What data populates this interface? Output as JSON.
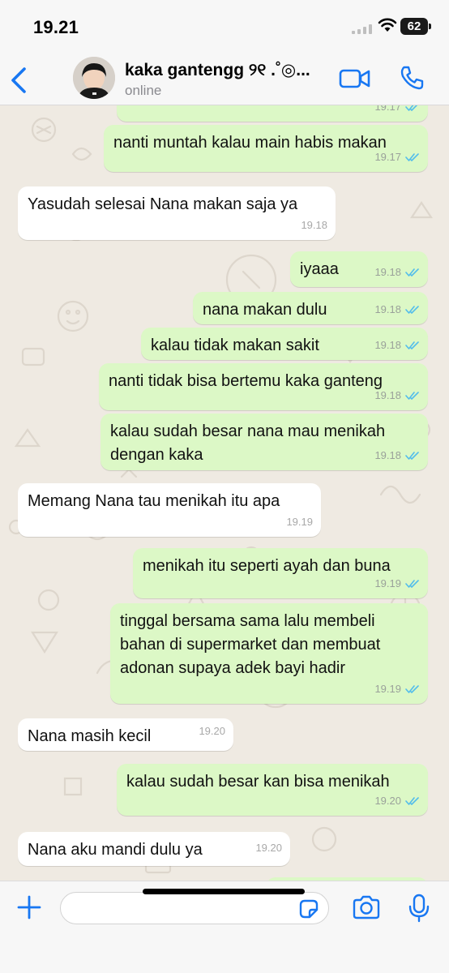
{
  "status_bar": {
    "time": "19.21",
    "battery": "62"
  },
  "header": {
    "back_label": "",
    "contact_name": "kaka gantengg ୨୧ . ˚✧ ... ",
    "contact_name_display": "kaka gantengg ୨୧ .˚◎...",
    "status": "online"
  },
  "messages": [
    {
      "direction": "out",
      "text": "",
      "time": "19.17",
      "read": true
    },
    {
      "direction": "out",
      "text": "nanti muntah kalau main habis makan",
      "time": "19.17",
      "read": true
    },
    {
      "direction": "in",
      "text": "Yasudah selesai Nana makan saja ya",
      "time": "19.18"
    },
    {
      "direction": "out",
      "text": "iyaaa",
      "time": "19.18",
      "read": true
    },
    {
      "direction": "out",
      "text": "nana makan dulu",
      "time": "19.18",
      "read": true
    },
    {
      "direction": "out",
      "text": "kalau tidak makan sakit",
      "time": "19.18",
      "read": true
    },
    {
      "direction": "out",
      "text": "nanti tidak bisa bertemu kaka ganteng",
      "time": "19.18",
      "read": true
    },
    {
      "direction": "out",
      "text": "kalau sudah besar nana mau menikah\ndengan kaka",
      "time": "19.18",
      "read": true
    },
    {
      "direction": "in",
      "text": "Memang Nana tau menikah itu apa",
      "time": "19.19"
    },
    {
      "direction": "out",
      "text": "menikah itu seperti ayah dan buna",
      "time": "19.19",
      "read": true
    },
    {
      "direction": "out",
      "text": "tinggal bersama sama lalu membeli\nbahan di supermarket dan membuat\nadonan supaya adek bayi hadir",
      "time": "19.19",
      "read": true
    },
    {
      "direction": "in",
      "text": "Nana masih kecil",
      "time": "19.20"
    },
    {
      "direction": "out",
      "text": "kalau sudah besar kan bisa menikah",
      "time": "19.20",
      "read": true
    },
    {
      "direction": "in",
      "text": "Nana aku mandi dulu ya",
      "time": "19.20"
    }
  ],
  "composer": {
    "placeholder": ""
  },
  "colors": {
    "accent": "#1877f2",
    "outgoing_bubble": "#dcf8c6",
    "incoming_bubble": "#ffffff",
    "read_ticks": "#53bdeb",
    "chat_background": "#efeae2"
  },
  "icons": [
    "back-icon",
    "video-icon",
    "phone-icon",
    "plus-icon",
    "sticker-icon",
    "camera-icon",
    "mic-icon",
    "read-receipt-icon"
  ]
}
